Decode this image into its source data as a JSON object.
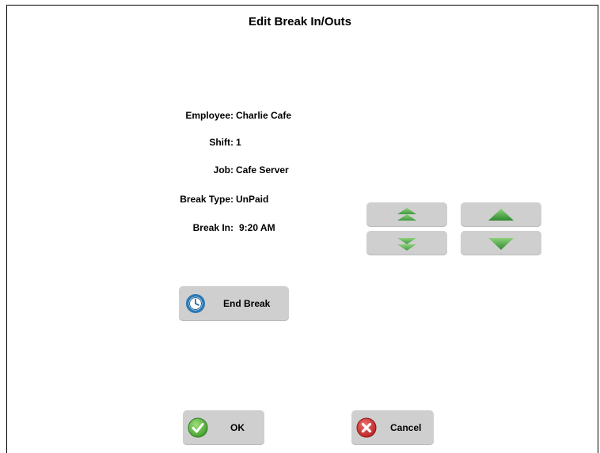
{
  "dialog": {
    "title": "Edit Break In/Outs"
  },
  "fields": [
    {
      "label": "Employee:",
      "value": "Charlie Cafe"
    },
    {
      "label": "Shift:",
      "value": "1"
    },
    {
      "label": "Job:",
      "value": "Cafe Server"
    },
    {
      "label": "Break Type:",
      "value": "UnPaid"
    },
    {
      "label": "Break In:",
      "value": "9:20 AM"
    }
  ],
  "buttons": {
    "end_break": "End Break",
    "ok": "OK",
    "cancel": "Cancel"
  },
  "icons": {
    "end_break": "clock-icon",
    "ok": "check-icon",
    "cancel": "close-icon",
    "fast_up": "double-chevron-up-icon",
    "fast_down": "double-chevron-down-icon",
    "up": "triangle-up-icon",
    "down": "triangle-down-icon"
  },
  "colors": {
    "button_bg": "#cfcfcf",
    "arrow_green": "#3f9a3f",
    "clock_blue": "#2a78b5",
    "ok_green": "#4aa832",
    "cancel_red": "#c62a2a"
  }
}
